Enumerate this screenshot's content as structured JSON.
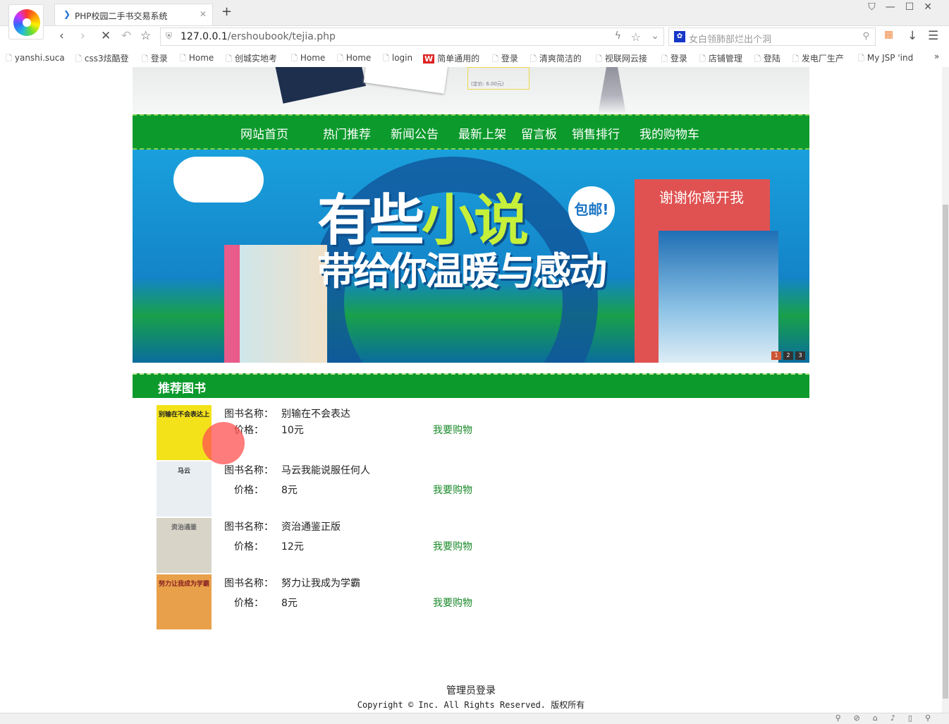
{
  "browser": {
    "tab_title": "PHP校园二手书交易系统",
    "url_host": "127.0.0.1",
    "url_path": "/ershoubook/tejia.php",
    "search_placeholder": "女白领肺部烂出个洞",
    "bookmarks": [
      "yanshi.suca",
      "css3炫酷登",
      "登录",
      "Home",
      "创城实地考",
      "Home",
      "Home",
      "login",
      "简单通用的",
      "登录",
      "清爽简洁的",
      "视联网云接",
      "登录",
      "店铺管理",
      "登陆",
      "发电厂生产",
      "My JSP 'ind"
    ]
  },
  "header": {
    "price_note": "(定价: 6.00元)"
  },
  "menu": [
    "网站首页",
    "热门推荐",
    "新闻公告",
    "最新上架",
    "留言板",
    "销售排行",
    "我的购物车"
  ],
  "banner": {
    "line1a": "有些",
    "line1b": "小说",
    "line2": "带给你温暖与感动",
    "badge": "包邮!",
    "book_title": "谢谢你离开我",
    "slides": [
      "1",
      "2",
      "3"
    ],
    "active_slide": 1
  },
  "section_title": "推荐图书",
  "labels": {
    "name": "图书名称：",
    "price": "价格：",
    "buy": "我要购物"
  },
  "books": [
    {
      "name": "别输在不会表达",
      "price": "10元",
      "cover_text": "别输在不会表达上",
      "cover_color": "#f3e21a"
    },
    {
      "name": "马云我能说服任何人",
      "price": "8元",
      "cover_text": "马云",
      "cover_color": "#e8eef2"
    },
    {
      "name": "资治通鉴正版",
      "price": "12元",
      "cover_text": "资治通鉴",
      "cover_color": "#d8d4c8"
    },
    {
      "name": "努力让我成为学霸",
      "price": "8元",
      "cover_text": "努力让我成为学霸",
      "cover_color": "#e9a04a"
    }
  ],
  "footer": {
    "admin_login": "管理员登录",
    "copyright": "Copyright © Inc. All Rights Reserved. 版权所有"
  },
  "colors": {
    "green": "#0c9a2c",
    "link": "#1a8a2a"
  }
}
